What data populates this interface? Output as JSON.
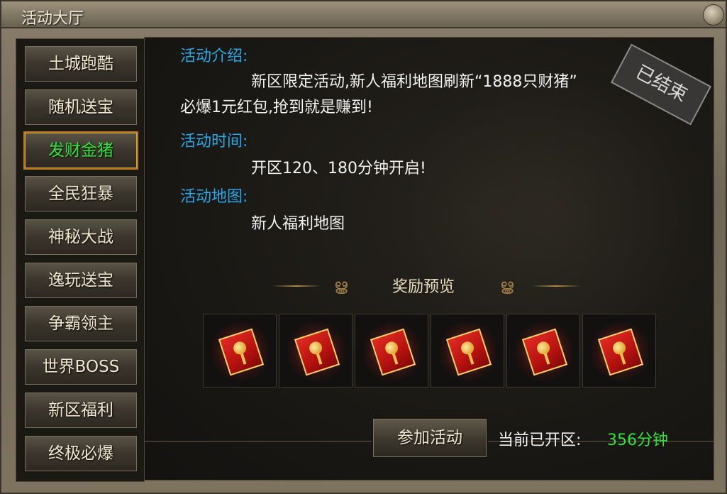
{
  "window": {
    "title": "活动大厅"
  },
  "sidebar": {
    "items": [
      {
        "label": "土城跑酷"
      },
      {
        "label": "随机送宝"
      },
      {
        "label": "发财金猪",
        "active": true
      },
      {
        "label": "全民狂暴"
      },
      {
        "label": "神秘大战"
      },
      {
        "label": "逸玩送宝"
      },
      {
        "label": "争霸领主"
      },
      {
        "label": "世界BOSS"
      },
      {
        "label": "新区福利"
      },
      {
        "label": "终极必爆"
      }
    ]
  },
  "activity": {
    "intro_label": "活动介绍:",
    "intro_line1": "新区限定活动,新人福利地图刷新“1888只财猪”",
    "intro_line2": "必爆1元红包,抢到就是赚到!",
    "time_label": "活动时间:",
    "time_text": "开区120、180分钟开启!",
    "map_label": "活动地图:",
    "map_text": "新人福利地图",
    "status_stamp": "已结束"
  },
  "rewards": {
    "title": "奖励预览",
    "items": [
      {
        "icon": "red-envelope-icon"
      },
      {
        "icon": "red-envelope-icon"
      },
      {
        "icon": "red-envelope-icon"
      },
      {
        "icon": "red-envelope-icon"
      },
      {
        "icon": "red-envelope-icon"
      },
      {
        "icon": "red-envelope-icon"
      }
    ]
  },
  "footer": {
    "join_label": "参加活动",
    "opened_label": "当前已开区:",
    "opened_value": "356分钟"
  },
  "colors": {
    "label_blue": "#2aa7e6",
    "highlight_green": "#35e03a",
    "active_border": "#b8781c"
  }
}
